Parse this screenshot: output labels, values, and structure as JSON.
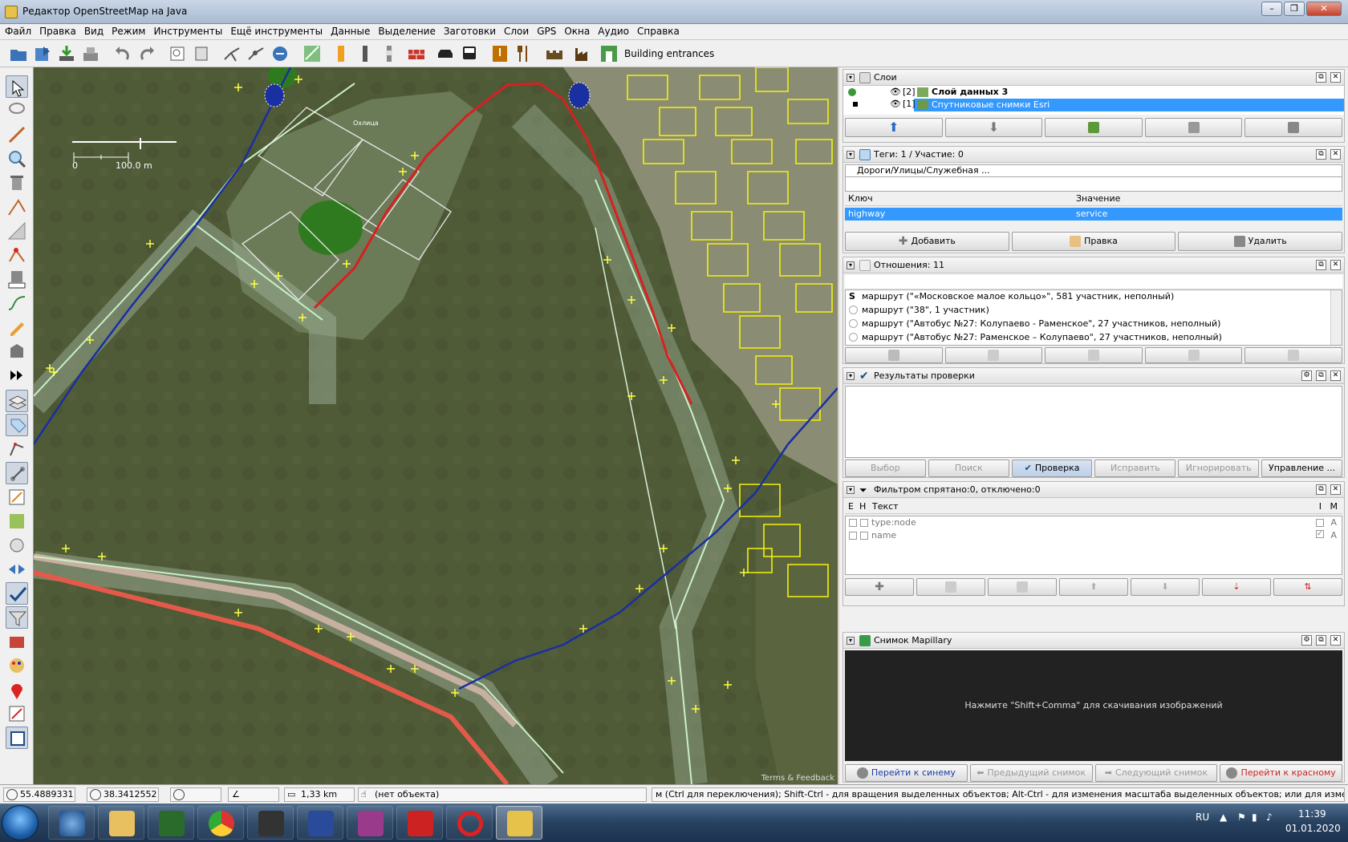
{
  "window": {
    "title": "Редактор OpenStreetMap на Java",
    "buttons": [
      "–",
      "❐",
      "✕"
    ]
  },
  "menu": [
    "Файл",
    "Правка",
    "Вид",
    "Режим",
    "Инструменты",
    "Ещё инструменты",
    "Данные",
    "Выделение",
    "Заготовки",
    "Слои",
    "GPS",
    "Окна",
    "Аудио",
    "Справка"
  ],
  "toolbar": {
    "building_entrances": "Building entrances"
  },
  "map": {
    "scale_zero": "0",
    "scale_label": "100.0 m",
    "place_label": "Охлица",
    "attribution": "Terms & Feedback"
  },
  "layers": {
    "title": "Слои",
    "items": [
      {
        "index": "[2]",
        "name": "Слой данных 3",
        "bold": true,
        "selected": false
      },
      {
        "index": "[1]",
        "name": "Спутниковые снимки Esri",
        "bold": false,
        "selected": true
      }
    ]
  },
  "tags": {
    "title": "Теги: 1 / Участие: 0",
    "preset": "Дороги/Улицы/Служебная ...",
    "col_key": "Ключ",
    "col_value": "Значение",
    "rows": [
      {
        "key": "highway",
        "value": "service"
      }
    ],
    "btn_add": "Добавить",
    "btn_edit": "Правка",
    "btn_delete": "Удалить"
  },
  "relations": {
    "title": "Отношения: 11",
    "items": [
      "маршрут (\"«Московское малое кольцо»\", 581 участник, неполный)",
      "маршрут (\"38\", 1 участник)",
      "маршрут (\"Автобус №27: Колупаево - Раменское\", 27 участников, неполный)",
      "маршрут (\"Автобус №27: Раменское – Колупаево\", 27 участников, неполный)"
    ]
  },
  "validation": {
    "title": "Результаты проверки",
    "buttons": [
      "Выбор",
      "Поиск",
      "Проверка",
      "Исправить",
      "Игнорировать",
      "Управление ..."
    ]
  },
  "filter": {
    "title": "Фильтром спрятано:0, отключено:0",
    "col_e": "E",
    "col_h": "Н",
    "col_text": "Текст",
    "col_i": "I",
    "col_m": "M",
    "rows": [
      {
        "text": "type:node",
        "m": "A",
        "i_checked": false
      },
      {
        "text": "name",
        "m": "A",
        "i_checked": true
      }
    ]
  },
  "mapillary": {
    "title": "Снимок Mapillary",
    "hint": "Нажмите \"Shift+Comma\" для скачивания изображений",
    "btn_blue": "Перейти к синему",
    "btn_prev": "Предыдущий снимок",
    "btn_next": "Следующий снимок",
    "btn_red": "Перейти к красному"
  },
  "status": {
    "lat": "55.4889331",
    "lon": "38.3412552",
    "length": "1,33 km",
    "object": "(нет объекта)",
    "help": "м (Ctrl для переключения); Shift-Ctrl - для вращения выделенных объектов; Alt-Ctrl - для изменения масштаба выделенных объектов; или для изменения выделения"
  },
  "taskbar": {
    "lang": "RU",
    "time": "11:39",
    "date": "01.01.2020"
  },
  "colors": {
    "selection": "#3399ff",
    "route_red": "#d82020",
    "building_yellow": "#f4f20a",
    "route_blue": "#1a2fa0"
  }
}
